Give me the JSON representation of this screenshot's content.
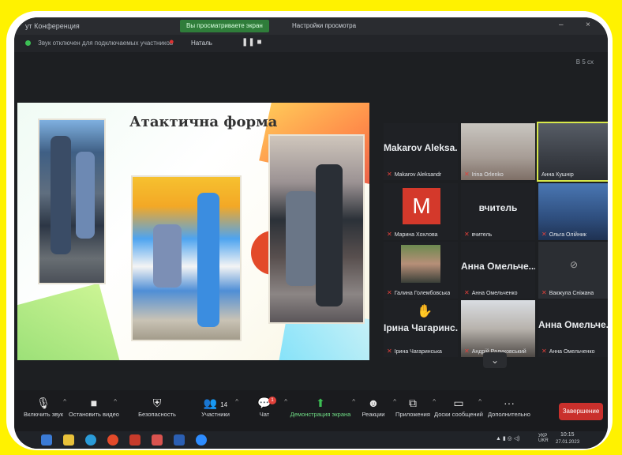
{
  "window": {
    "title": "ут Конференция",
    "view_tag": "Вы просматриваете экран",
    "view_settings": "Настройки просмотра",
    "minimize": "–",
    "close": "×"
  },
  "subbar": {
    "notice": "Звук отключен для подключаемых участников",
    "speaker": "Наталь",
    "pause_stop": "❚❚ ■"
  },
  "zoom_pct": "В 5 сх",
  "slide": {
    "title": "Атактична форма"
  },
  "gallery": [
    {
      "big": "Makarov Aleksa...",
      "small": "Makarov Aleksandr"
    },
    {
      "big": "",
      "small": "Irina Orlenko"
    },
    {
      "big": "",
      "small": "Анна Кушнір"
    },
    {
      "big": "M",
      "small": "Марина Хохлова"
    },
    {
      "big": "вчитель",
      "small": "вчитель"
    },
    {
      "big": "",
      "small": "Ольга Олійник"
    },
    {
      "big": "",
      "small": "Галина Голембовська"
    },
    {
      "big": "Анна Омельче...",
      "small": "Анна Омельченко"
    },
    {
      "big": "",
      "small": "Вакжула Сніжана"
    },
    {
      "big": "Ірина Чагаринс...",
      "small": "Ірина Чагаринська"
    },
    {
      "big": "",
      "small": "Андрій Радиковський"
    },
    {
      "big": "Анна Омельче...",
      "small": "Анна Омельченко"
    }
  ],
  "toolbar": {
    "mute": "Включить звук",
    "stop_video": "Остановить видео",
    "security": "Безопасность",
    "participants": "Участники",
    "participants_count": "14",
    "chat": "Чат",
    "chat_badge": "1",
    "share": "Демонстрация экрана",
    "reactions": "Реакции",
    "apps": "Приложения",
    "whiteboards": "Доски сообщений",
    "more": "Дополнительно",
    "end": "Завершение"
  },
  "taskbar": {
    "lang": "УКР\nUKR",
    "time": "10:15",
    "date": "27.01.2023"
  }
}
